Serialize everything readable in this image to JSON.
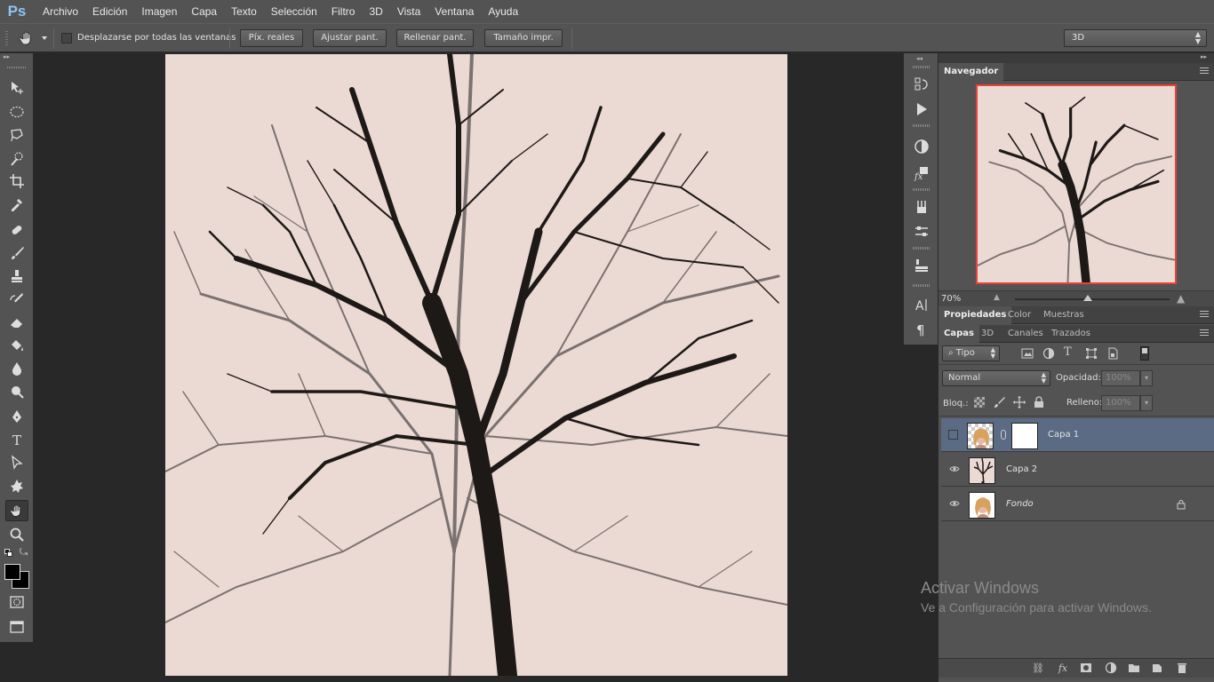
{
  "app": {
    "logo": "Ps"
  },
  "menu": [
    "Archivo",
    "Edición",
    "Imagen",
    "Capa",
    "Texto",
    "Selección",
    "Filtro",
    "3D",
    "Vista",
    "Ventana",
    "Ayuda"
  ],
  "options": {
    "scroll_all_label": "Desplazarse por todas las ventanas",
    "buttons": [
      "Píx. reales",
      "Ajustar pant.",
      "Rellenar pant.",
      "Tamaño impr."
    ],
    "workspace": "3D"
  },
  "navigator": {
    "tab": "Navegador",
    "zoom": "70%"
  },
  "properties_tabs": [
    "Propiedades",
    "Color",
    "Muestras"
  ],
  "layers_tabs": [
    "Capas",
    "3D",
    "Canales",
    "Trazados"
  ],
  "layers": {
    "filter_kind": "Tipo",
    "blend_mode": "Normal",
    "opacity_label": "Opacidad:",
    "opacity_value": "100%",
    "lock_label": "Bloq.:",
    "fill_label": "Relleno:",
    "fill_value": "100%",
    "items": [
      {
        "name": "Capa 1",
        "visible": false,
        "selected": true,
        "has_mask": true
      },
      {
        "name": "Capa 2",
        "visible": true,
        "selected": false
      },
      {
        "name": "Fondo",
        "visible": true,
        "selected": false,
        "locked": true
      }
    ]
  },
  "watermark": {
    "title": "Activar Windows",
    "subtitle": "Ve a Configuración para activar Windows."
  },
  "colors": {
    "canvas_bg": "#ebd9d3",
    "nav_border": "#e6443a",
    "selected_layer": "#5b6b84",
    "logo": "#8ec5f0"
  }
}
